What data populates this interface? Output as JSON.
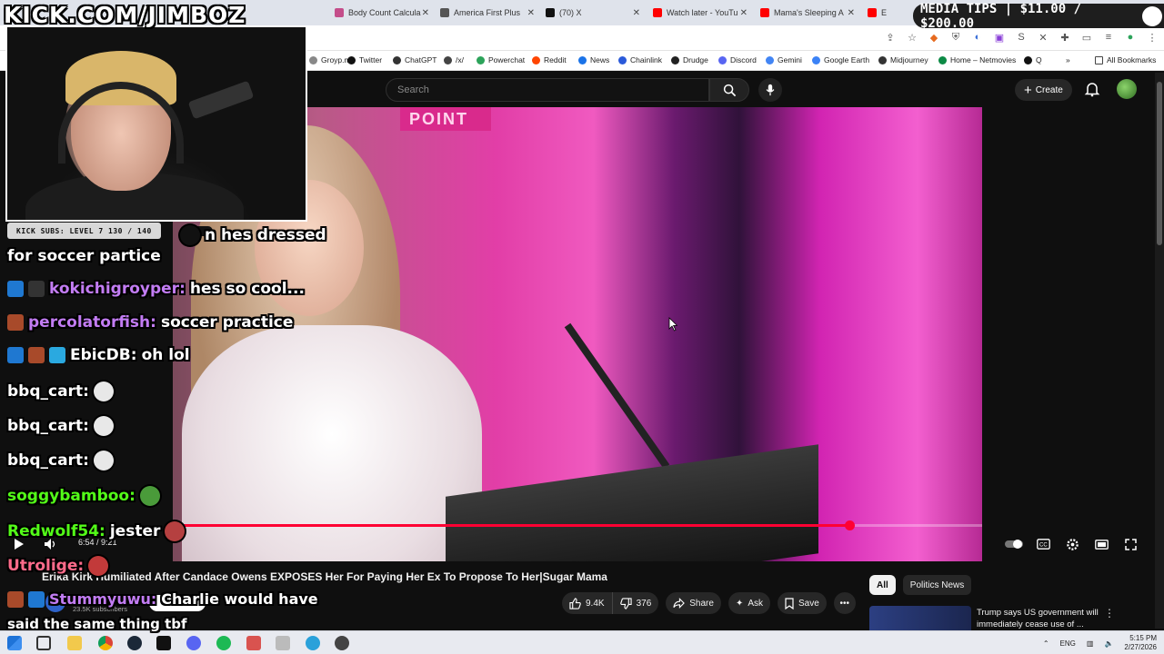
{
  "overlay": {
    "watermark": "KICK.COM/JIMBOZ",
    "subs_label": "KICK SUBS: LEVEL 7 130 / 140",
    "media_tips": "MEDIA TIPS | $11.00 / $200.00"
  },
  "browser": {
    "tabs": [
      {
        "label": "Body Count Calcula",
        "fav_color": "#c44d8a"
      },
      {
        "label": "America First Plus",
        "fav_color": "#555555"
      },
      {
        "label": "(70) X",
        "fav_color": "#111111"
      },
      {
        "label": "Watch later - YouTu",
        "fav_color": "#ff0000"
      },
      {
        "label": "Mama's Sleeping A",
        "fav_color": "#ff0000"
      },
      {
        "label": "E",
        "fav_color": "#ff0000"
      }
    ],
    "bookmarks": [
      {
        "label": "Groyp.me",
        "color": "#888888"
      },
      {
        "label": "Twitter",
        "color": "#111111"
      },
      {
        "label": "ChatGPT",
        "color": "#333333"
      },
      {
        "label": "/x/",
        "color": "#444444"
      },
      {
        "label": "Powerchat",
        "color": "#2ca35a"
      },
      {
        "label": "Reddit",
        "color": "#ff4500"
      },
      {
        "label": "News",
        "color": "#1a73e8"
      },
      {
        "label": "Chainlink",
        "color": "#2a5ada"
      },
      {
        "label": "Drudge",
        "color": "#222222"
      },
      {
        "label": "Discord",
        "color": "#5865f2"
      },
      {
        "label": "Gemini",
        "color": "#4285f4"
      },
      {
        "label": "Google Earth",
        "color": "#3b82f6"
      },
      {
        "label": "Midjourney",
        "color": "#333333"
      },
      {
        "label": "Home – Netmovies",
        "color": "#0c8a45"
      },
      {
        "label": "Q",
        "color": "#111111"
      }
    ],
    "all_bookmarks": "All Bookmarks"
  },
  "youtube": {
    "search_placeholder": "Search",
    "create_label": "Create",
    "time": "6:54 / 9:21",
    "progress": 0.836,
    "video_title": "Erika Kirk Humiliated After Candace Owens EXPOSES Her For Paying Her Ex To Propose To Her|Sugar Mama",
    "subscribers": "23.5K subscribers",
    "subscribe_label": "Subscribe",
    "likes": "9.4K",
    "dislikes": "376",
    "share": "Share",
    "ask": "Ask",
    "save": "Save",
    "chips": [
      "All",
      "Politics News"
    ],
    "recommended_title": "Trump says US government will immediately cease use of ..."
  },
  "chat": [
    {
      "user": "",
      "text": "n hes dressed",
      "color": "#ffffff",
      "emote": true
    },
    {
      "user": "",
      "text": "for soccer partice",
      "color": "#ffffff"
    },
    {
      "user": "kokichigroyper:",
      "text": "hes so cool...",
      "color": "#c27cf3",
      "badges": [
        "#1f78d1",
        "#333333"
      ]
    },
    {
      "user": "percolatorfish:",
      "text": "soccer practice",
      "color": "#c27cf3",
      "badges": [
        "#a84a2a"
      ]
    },
    {
      "user": "EbicDB:",
      "text": "oh lol",
      "color": "#ffffff",
      "badges": [
        "#1f78d1",
        "#a84a2a",
        "#2aa9e0"
      ]
    },
    {
      "user": "bbq_cart:",
      "text": "",
      "color": "#ffffff",
      "emote": true
    },
    {
      "user": "bbq_cart:",
      "text": "",
      "color": "#ffffff",
      "emote": true
    },
    {
      "user": "bbq_cart:",
      "text": "",
      "color": "#ffffff",
      "emote": true
    },
    {
      "user": "soggybamboo:",
      "text": "",
      "color": "#53fc18",
      "emote": true
    },
    {
      "user": "Redwolf54:",
      "text": "jester",
      "color": "#53fc18",
      "emote": true
    },
    {
      "user": "Utrolige:",
      "text": "",
      "color": "#ff6b8b",
      "emote": true
    },
    {
      "user": "Stummyuwu:",
      "text": "Charlie would have",
      "color": "#c27cf3",
      "badges": [
        "#a84a2a",
        "#1f78d1"
      ]
    },
    {
      "user": "",
      "text": "said the same thing tbf",
      "color": "#ffffff"
    }
  ],
  "taskbar": {
    "lang": "ENG",
    "time": "5:15 PM",
    "date": "2/27/2026"
  }
}
